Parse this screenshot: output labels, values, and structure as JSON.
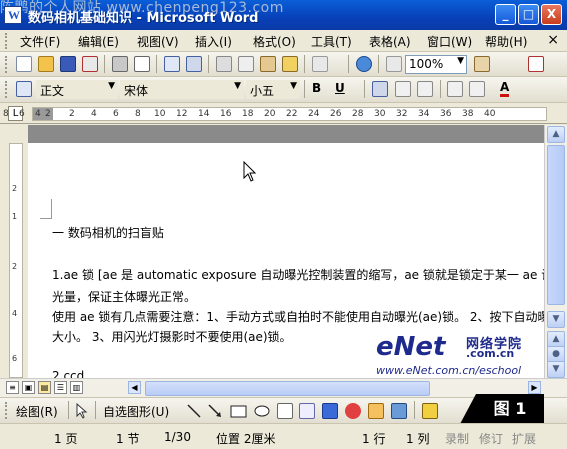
{
  "window": {
    "title": "数码相机基础知识 - Microsoft Word",
    "watermark": "陈鹏的个人网站 www.chenpeng123.com",
    "buttons": {
      "minimize": "_",
      "maximize": "□",
      "close": "X"
    }
  },
  "menubar": {
    "items": [
      "文件(F)",
      "编辑(E)",
      "视图(V)",
      "插入(I)",
      "格式(O)",
      "工具(T)",
      "表格(A)",
      "窗口(W)",
      "帮助(H)"
    ],
    "close_doc": "×"
  },
  "standard_toolbar": {
    "zoom": "100%"
  },
  "format_toolbar": {
    "style": "正文",
    "font": "宋体",
    "size": "小五",
    "bold": "B",
    "underline": "U",
    "font_color_label": "A"
  },
  "ruler": {
    "tab_glyph": "L",
    "ticks": [
      "8",
      "6",
      "4",
      "2",
      "2",
      "4",
      "6",
      "8",
      "10",
      "12",
      "14",
      "16",
      "18",
      "20",
      "22",
      "24",
      "26",
      "28",
      "30",
      "32",
      "34",
      "36",
      "38",
      "40"
    ]
  },
  "vruler": {
    "ticks": [
      "2",
      "1",
      "2",
      "4",
      "6"
    ]
  },
  "document": {
    "lines": [
      "一 数码相机的扫盲贴",
      "1.ae 锁  [ae 是 automatic exposure 自动曝光控制装置的缩写，ae 锁就是锁定于某一 ae 设置",
      "光量，保证主体曝光正常。",
      "使用 ae 锁有几点需要注意：1、手动方式或自拍时不能使用自动曝光(ae)锁。  2、按下自动曝",
      "大小。  3、用闪光灯摄影时不要使用(ae)锁。",
      "2.ccd"
    ]
  },
  "logo": {
    "brand": "eNet",
    "cn": "网络学院",
    "domain": ".com.cn",
    "url": "www.eNet.com.cn/eschool"
  },
  "drawing_toolbar": {
    "draw": "绘图(R)",
    "autoshapes": "自选图形(U)"
  },
  "figure_label": "图 1",
  "status": {
    "page": "1 页",
    "section": "1 节",
    "pages": "1/30",
    "position": "位置 2厘米",
    "line": "1 行",
    "column": "1 列",
    "rec": "录制",
    "trk": "修订",
    "ext": "扩展"
  },
  "colors": {
    "title_bar": "#0a5fd8",
    "logo": "#1e2a8c",
    "squiggle": "#e02020"
  }
}
